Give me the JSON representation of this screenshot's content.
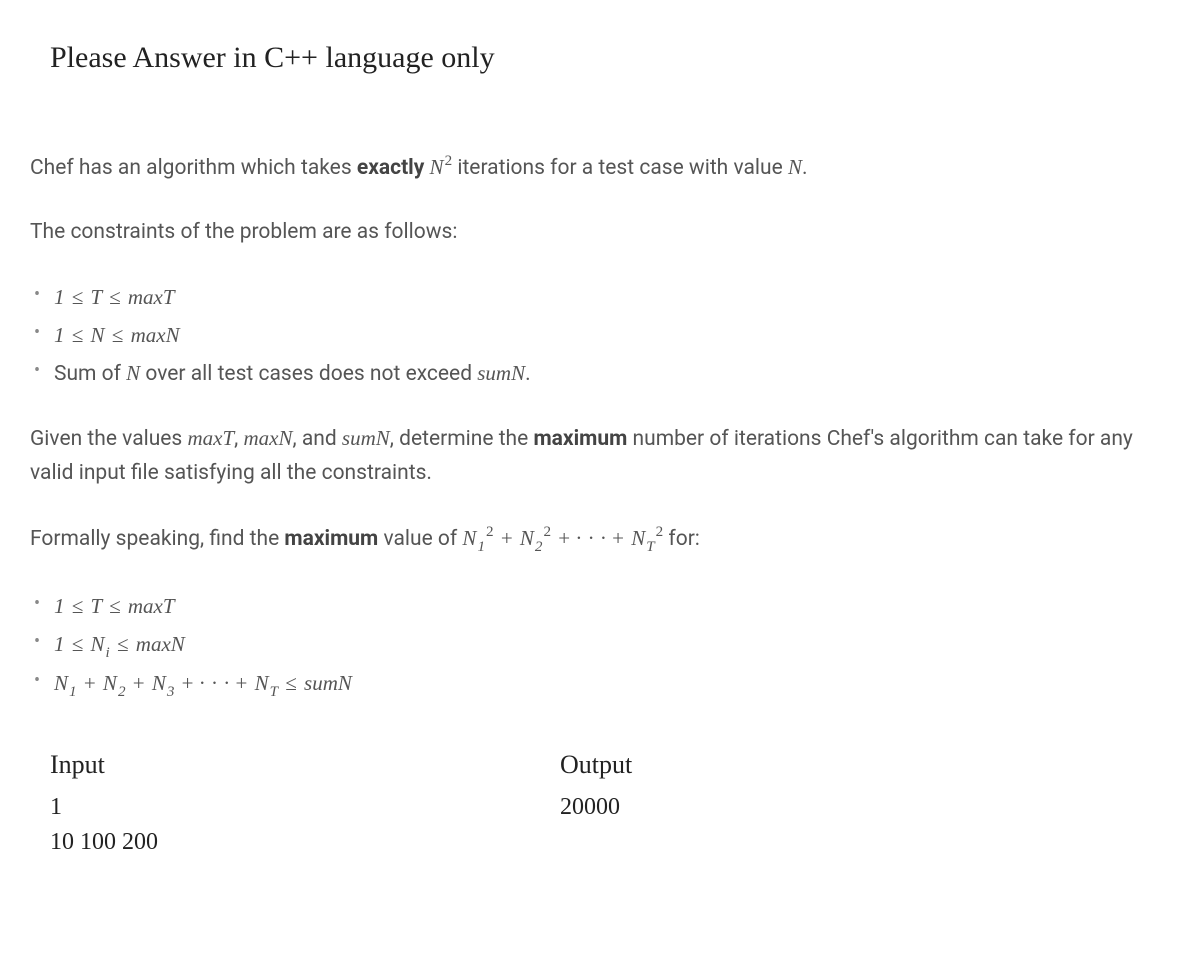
{
  "title": "Please Answer in C++ language only",
  "para1_a": "Chef has an algorithm which takes ",
  "para1_bold": "exactly",
  "para1_b": " iterations for a test case with value ",
  "para2": "The constraints of the problem are as follows:",
  "c1_a": "1",
  "c1_b": "T",
  "c1_c": "maxT",
  "c2_a": "1",
  "c2_b": "N",
  "c2_c": "maxN",
  "c3_a": "Sum of ",
  "c3_b": "N",
  "c3_c": " over all test cases does not exceed ",
  "c3_d": "sumN",
  "para3_a": "Given the values ",
  "para3_maxT": "maxT",
  "para3_maxN": "maxN",
  "para3_and": ", and ",
  "para3_sumN": "sumN",
  "para3_b": ", determine the ",
  "para3_bold": "maximum",
  "para3_c": " number of iterations Chef's algorithm can take for any valid input file satisfying all the constraints.",
  "para4_a": "Formally speaking, find the ",
  "para4_bold": "maximum",
  "para4_b": " value of ",
  "para4_c": " for:",
  "d1_a": "1",
  "d1_b": "T",
  "d1_c": "maxT",
  "d2_a": "1",
  "d2_c": "maxN",
  "d3_sum": "sumN",
  "io": {
    "input_label": "Input",
    "output_label": "Output",
    "input_text": "1\n10 100 200",
    "output_text": "20000"
  }
}
